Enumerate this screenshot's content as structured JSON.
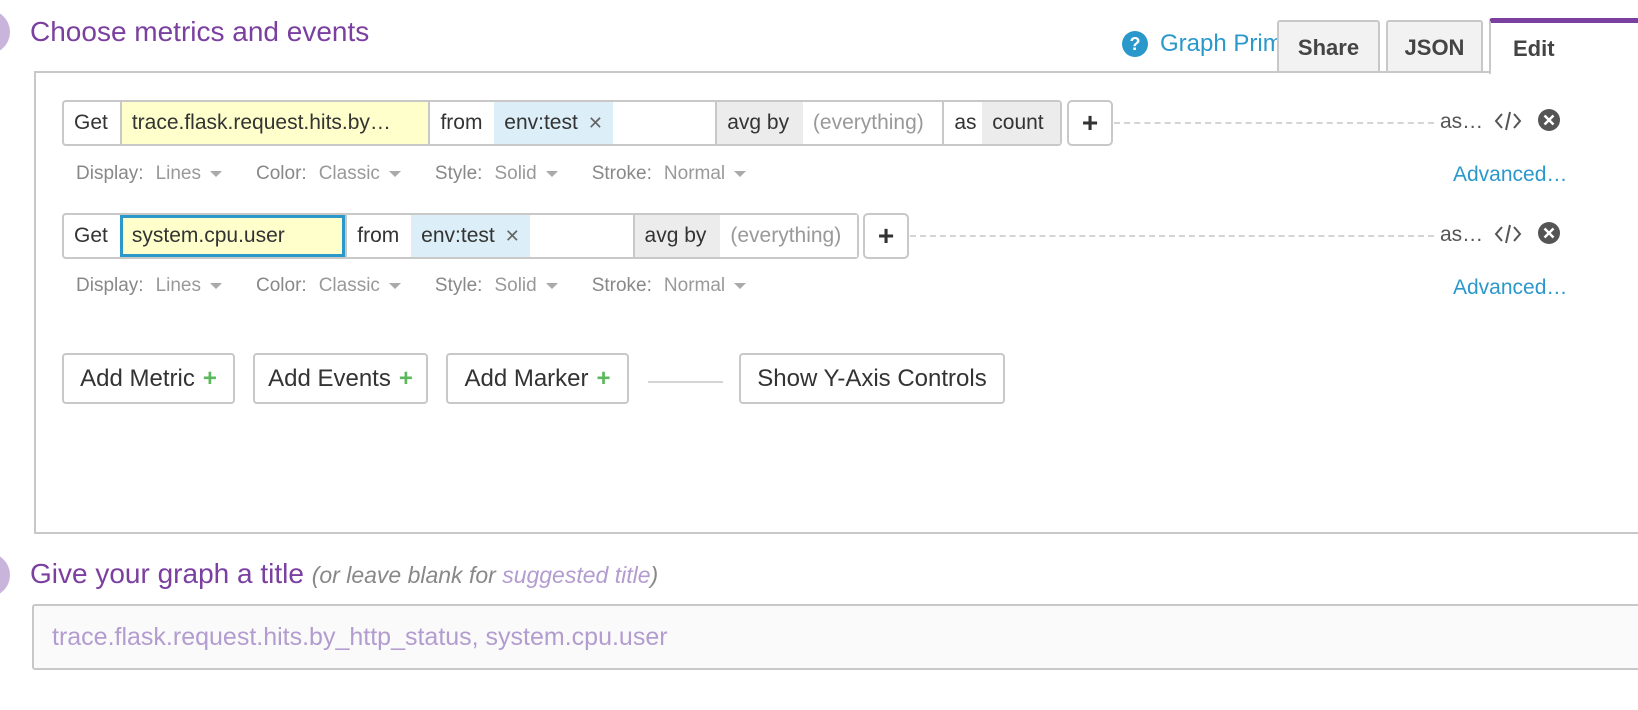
{
  "steps": {
    "metrics": {
      "title": "Choose metrics and events"
    },
    "title": {
      "title": "Give your graph a title",
      "hint_prefix": "(or leave blank for ",
      "hint_link": "suggested title",
      "hint_suffix": ")"
    }
  },
  "header": {
    "primer_label": "Graph Primer",
    "primer_icon": "?",
    "tabs": [
      "Share",
      "JSON",
      "Edit"
    ],
    "active_tab": "Edit"
  },
  "queries": [
    {
      "get_label": "Get",
      "metric": "trace.flask.request.hits.by…",
      "from_label": "from",
      "tag": "env:test",
      "agg_label": "avg by",
      "group": "(everything)",
      "as_label": "as",
      "as_value": "count",
      "alias": "as…",
      "options": {
        "display": {
          "label": "Display:",
          "value": "Lines"
        },
        "color": {
          "label": "Color:",
          "value": "Classic"
        },
        "style": {
          "label": "Style:",
          "value": "Solid"
        },
        "stroke": {
          "label": "Stroke:",
          "value": "Normal"
        }
      },
      "advanced": "Advanced…"
    },
    {
      "get_label": "Get",
      "metric": "system.cpu.user",
      "from_label": "from",
      "tag": "env:test",
      "agg_label": "avg by",
      "group": "(everything)",
      "alias": "as…",
      "options": {
        "display": {
          "label": "Display:",
          "value": "Lines"
        },
        "color": {
          "label": "Color:",
          "value": "Classic"
        },
        "style": {
          "label": "Style:",
          "value": "Solid"
        },
        "stroke": {
          "label": "Stroke:",
          "value": "Normal"
        }
      },
      "advanced": "Advanced…"
    }
  ],
  "actions": {
    "add_metric": "Add Metric",
    "add_events": "Add Events",
    "add_marker": "Add Marker",
    "plus": "+",
    "show_y_axis": "Show Y-Axis Controls"
  },
  "title_input": {
    "placeholder": "trace.flask.request.hits.by_http_status, system.cpu.user",
    "value": ""
  },
  "colors": {
    "accent_purple": "#7b3fa0",
    "link_blue": "#2b98cc",
    "metric_bg": "#ffffcc",
    "tag_bg": "#dceef7",
    "plus_green": "#5cb85c"
  }
}
